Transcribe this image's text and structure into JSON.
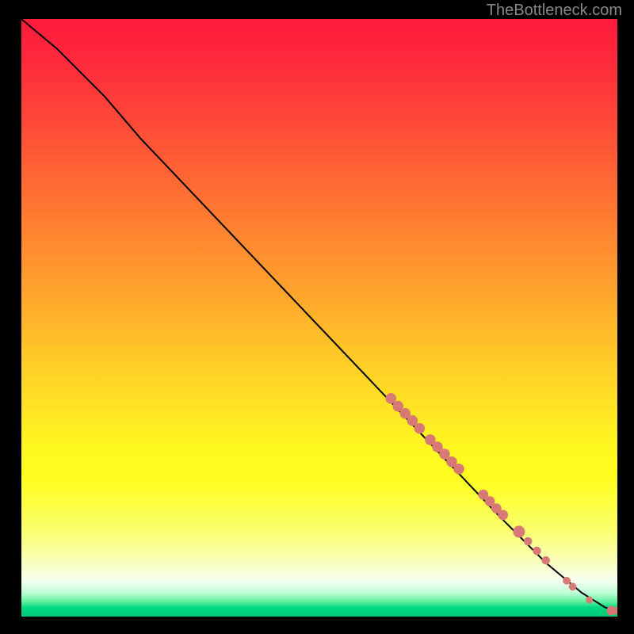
{
  "watermark": "TheBottleneck.com",
  "chart_data": {
    "type": "line",
    "title": "",
    "xlabel": "",
    "ylabel": "",
    "xlim": [
      0,
      100
    ],
    "ylim": [
      0,
      100
    ],
    "curve": [
      {
        "x": 0,
        "y": 100
      },
      {
        "x": 6,
        "y": 95
      },
      {
        "x": 14,
        "y": 87
      },
      {
        "x": 20,
        "y": 80
      },
      {
        "x": 30,
        "y": 69.5
      },
      {
        "x": 40,
        "y": 59
      },
      {
        "x": 50,
        "y": 48.5
      },
      {
        "x": 60,
        "y": 38
      },
      {
        "x": 70,
        "y": 27.5
      },
      {
        "x": 80,
        "y": 17
      },
      {
        "x": 88,
        "y": 9
      },
      {
        "x": 94,
        "y": 4
      },
      {
        "x": 98,
        "y": 1.5
      },
      {
        "x": 100,
        "y": 1
      }
    ],
    "scatter_points": [
      {
        "x": 62.0,
        "y": 36.5,
        "r": 0.9
      },
      {
        "x": 63.2,
        "y": 35.2,
        "r": 0.9
      },
      {
        "x": 64.4,
        "y": 34.0,
        "r": 0.9
      },
      {
        "x": 65.6,
        "y": 32.8,
        "r": 0.9
      },
      {
        "x": 66.8,
        "y": 31.5,
        "r": 0.9
      },
      {
        "x": 68.6,
        "y": 29.6,
        "r": 0.9
      },
      {
        "x": 69.8,
        "y": 28.4,
        "r": 0.9
      },
      {
        "x": 71.0,
        "y": 27.2,
        "r": 0.9
      },
      {
        "x": 72.2,
        "y": 25.9,
        "r": 0.9
      },
      {
        "x": 73.4,
        "y": 24.7,
        "r": 0.9
      },
      {
        "x": 77.5,
        "y": 20.4,
        "r": 0.85
      },
      {
        "x": 78.6,
        "y": 19.3,
        "r": 0.85
      },
      {
        "x": 79.7,
        "y": 18.1,
        "r": 0.85
      },
      {
        "x": 80.8,
        "y": 17.0,
        "r": 0.85
      },
      {
        "x": 83.5,
        "y": 14.2,
        "r": 1.0
      },
      {
        "x": 85.0,
        "y": 12.6,
        "r": 0.7
      },
      {
        "x": 86.5,
        "y": 11.0,
        "r": 0.7
      },
      {
        "x": 88.0,
        "y": 9.4,
        "r": 0.7
      },
      {
        "x": 91.5,
        "y": 6.0,
        "r": 0.65
      },
      {
        "x": 92.5,
        "y": 5.0,
        "r": 0.65
      },
      {
        "x": 95.3,
        "y": 2.8,
        "r": 0.6
      },
      {
        "x": 99.0,
        "y": 1.0,
        "r": 0.8
      },
      {
        "x": 100.3,
        "y": 1.0,
        "r": 0.8
      }
    ],
    "point_color": "#d77a75",
    "curve_color": "#000000"
  }
}
